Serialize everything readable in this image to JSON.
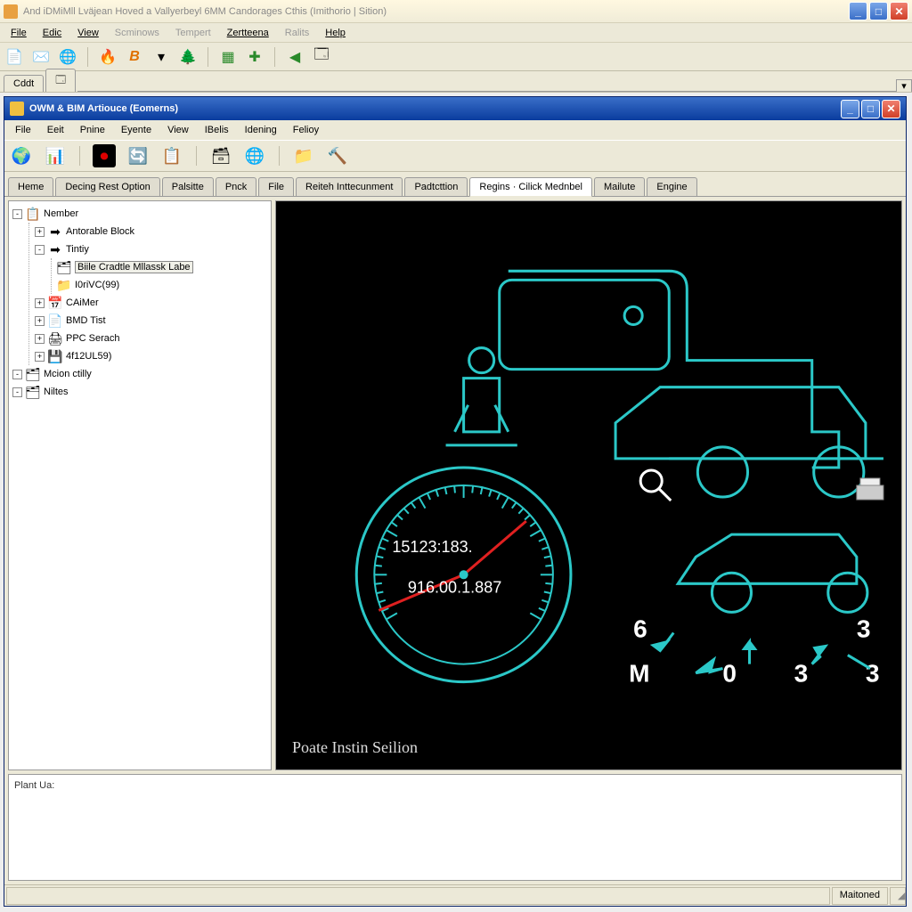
{
  "colors": {
    "diagram_stroke": "#2bc8c8",
    "accent_red": "#e02020"
  },
  "outer": {
    "title": "And iDMiMll Lväjean Hoved a Vallyerbeyl 6MM Candorages Cthis (Imithorio | Sition)",
    "menus": [
      "File",
      "Edic",
      "View",
      "Scminows",
      "Tempert",
      "Zertteena",
      "Ralits",
      "Help"
    ],
    "tabs": {
      "left": "Cddt"
    },
    "win_controls": {
      "min_symbol": "_",
      "max_symbol": "□",
      "close_symbol": "✕"
    }
  },
  "child": {
    "title": "OWM & BIM Artiouce (Eomerns)",
    "menus": [
      "File",
      "Eeit",
      "Pnine",
      "Eyente",
      "View",
      "IBelis",
      "Idening",
      "Felioy"
    ],
    "doc_tabs": [
      {
        "label": "Heme",
        "active": false
      },
      {
        "label": "Decing Rest Option",
        "active": false
      },
      {
        "label": "Palsitte",
        "active": false
      },
      {
        "label": "Pnck",
        "active": false
      },
      {
        "label": "File",
        "active": false
      },
      {
        "label": "Reiteh Inttecunment",
        "active": false
      },
      {
        "label": "Padtcttion",
        "active": false
      },
      {
        "label": "Regins · Cilick Mednbel",
        "active": true
      },
      {
        "label": "Mailute",
        "active": false
      },
      {
        "label": "Engine",
        "active": false
      }
    ],
    "tree": {
      "root": "Nember",
      "items": [
        {
          "label": "Antorable Block",
          "icon": "➡"
        },
        {
          "label": "Tintiy",
          "icon": "➡",
          "children": [
            {
              "label": "Biile Cradtle Mllassk Labe",
              "icon": "🗂",
              "selected": true
            },
            {
              "label": "I0riVC(99)",
              "icon": "📁"
            }
          ]
        },
        {
          "label": "CAiMer",
          "icon": "📅"
        },
        {
          "label": "BMD Tist",
          "icon": "📄"
        },
        {
          "label": "PPC Serach",
          "icon": "🖨"
        },
        {
          "label": "4f12UL59)",
          "icon": "💾"
        }
      ],
      "tail": [
        {
          "label": "Mcion ctilly",
          "icon": "🗂"
        },
        {
          "label": "Niltes",
          "icon": "🗂"
        }
      ]
    },
    "viewer": {
      "caption": "Poate Instin Seilion",
      "gauge_digits": [
        "1",
        "5",
        "1",
        "2",
        "3",
        ":",
        "1",
        "8",
        "3",
        "9",
        "1",
        "6",
        ".",
        "0",
        "0",
        ".",
        "1",
        ".",
        "8",
        "8",
        "7"
      ],
      "wheel_labels": {
        "left_top": "6",
        "left_bot": "M",
        "mid": "0",
        "r1": "3",
        "r2_top": "3",
        "r2_bot": "3"
      }
    },
    "output_label": "Plant Ua:",
    "status_cell": "Maitoned"
  }
}
